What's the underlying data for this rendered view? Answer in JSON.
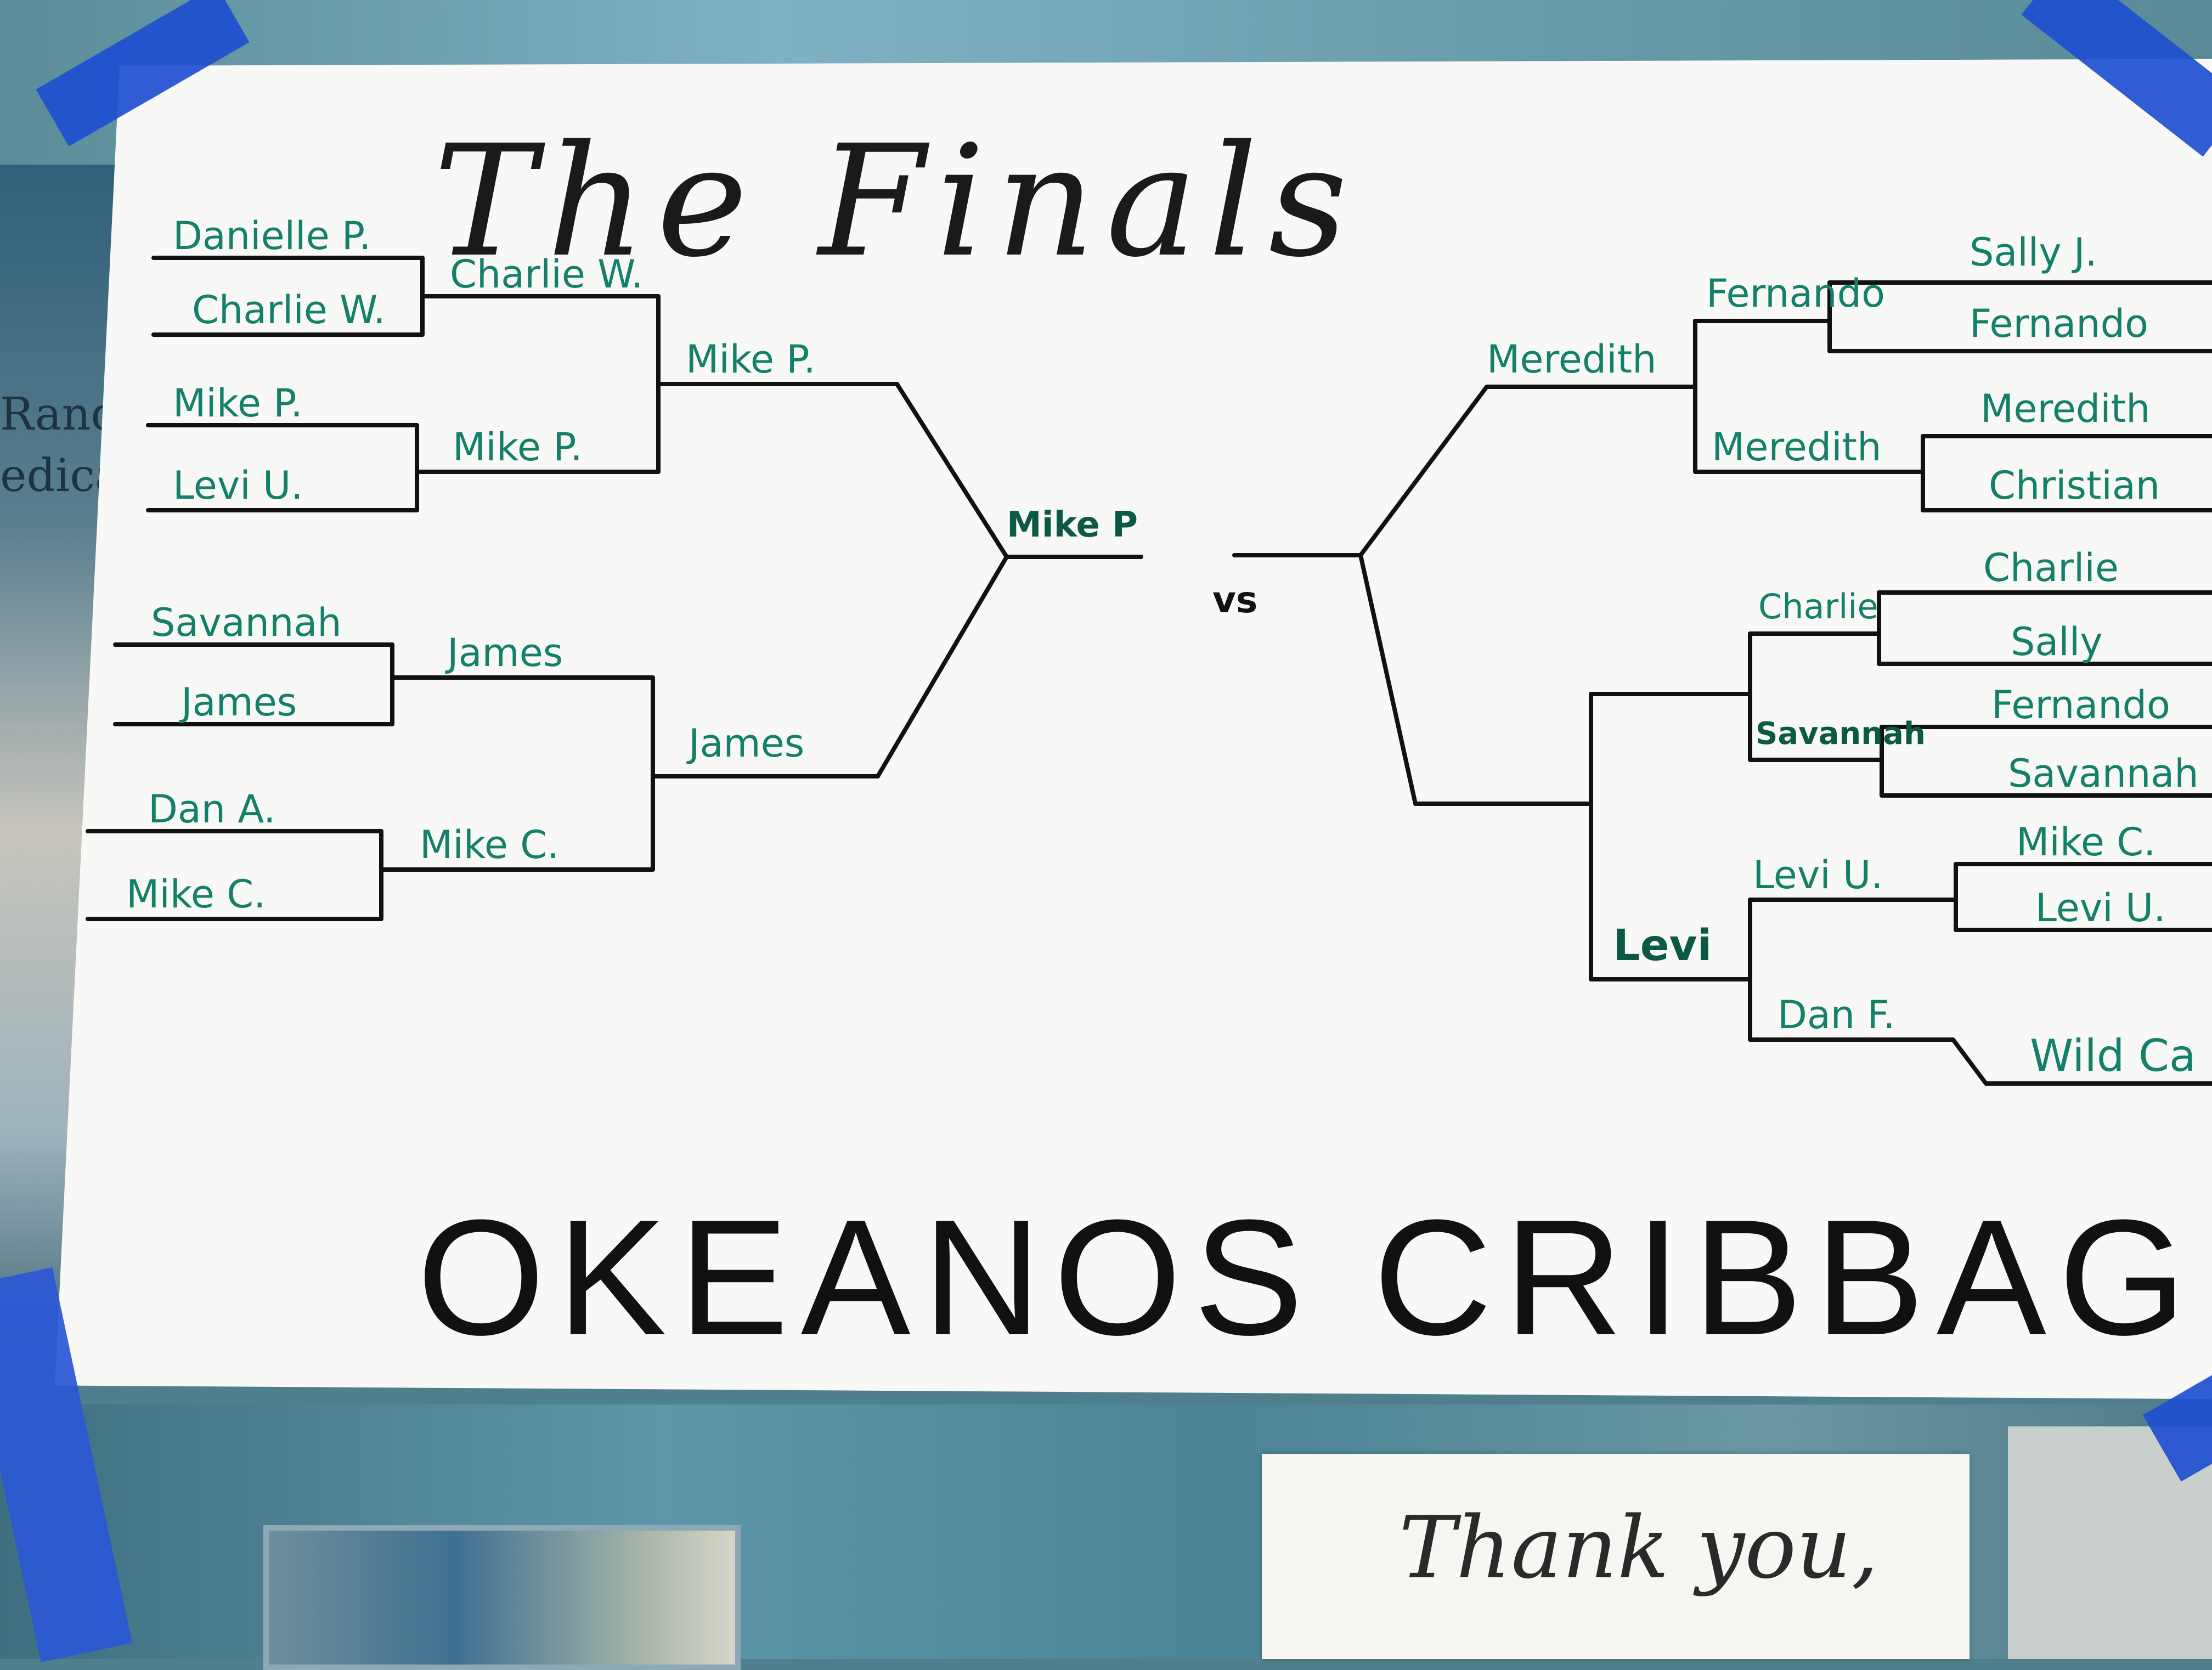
{
  "poster": {
    "title": "The Finals",
    "footer": "OKEANOS CRIBBAGE",
    "vs_label": "vs"
  },
  "background": {
    "left_text_line1": "Randy",
    "left_text_line2": "edica",
    "card_text": "Thank you,"
  },
  "left_bracket": {
    "round1": [
      "Danielle P.",
      "Charlie W.",
      "Mike P.",
      "Levi U.",
      "Savannah",
      "James",
      "Dan A.",
      "Mike C."
    ],
    "round2": [
      "Charlie W.",
      "Mike P.",
      "James",
      "Mike C."
    ],
    "round3": [
      "Mike P.",
      "James"
    ],
    "finalist": "Mike P"
  },
  "right_bracket": {
    "round1": [
      "Sally J.",
      "Fernando",
      "Meredith",
      "Christian",
      "Charlie",
      "Sally",
      "Fernando",
      "Savannah",
      "Mike C.",
      "Levi U.",
      "Wild Ca"
    ],
    "round2": [
      "Fernando",
      "Meredith",
      "Charlie",
      "Savannah",
      "Levi U.",
      "Dan F."
    ],
    "round3": [
      "Meredith",
      "Levi"
    ]
  },
  "colors": {
    "ink": "#111111",
    "marker_green": "#14806a",
    "tape_blue": "#1f4fd0",
    "paper": "#f8f8f6"
  }
}
